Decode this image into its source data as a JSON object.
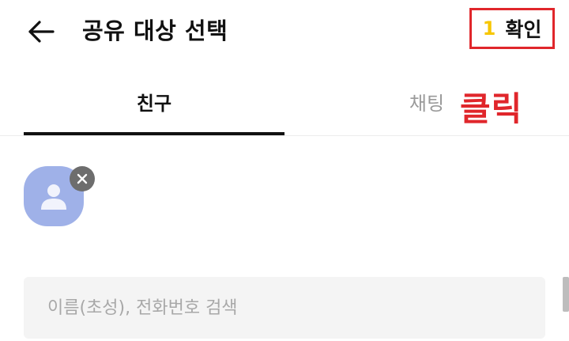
{
  "header": {
    "title": "공유 대상 선택",
    "back_icon": "arrow-left-icon",
    "confirm": {
      "count": "1",
      "label": "확인"
    }
  },
  "tabs": [
    {
      "label": "친구",
      "active": true
    },
    {
      "label": "채팅",
      "active": false
    }
  ],
  "annotation": {
    "text": "클릭",
    "color": "#e0262b"
  },
  "selected": [
    {
      "avatar_icon": "person-icon",
      "remove_icon": "close-icon"
    }
  ],
  "search": {
    "placeholder": "이름(초성), 전화번호 검색",
    "value": ""
  },
  "colors": {
    "accent_count": "#f7c600",
    "highlight_box": "#e0262b",
    "avatar_bg": "#9fb1e8",
    "active_tab": "#111111",
    "inactive_tab": "#9a9a9a"
  }
}
